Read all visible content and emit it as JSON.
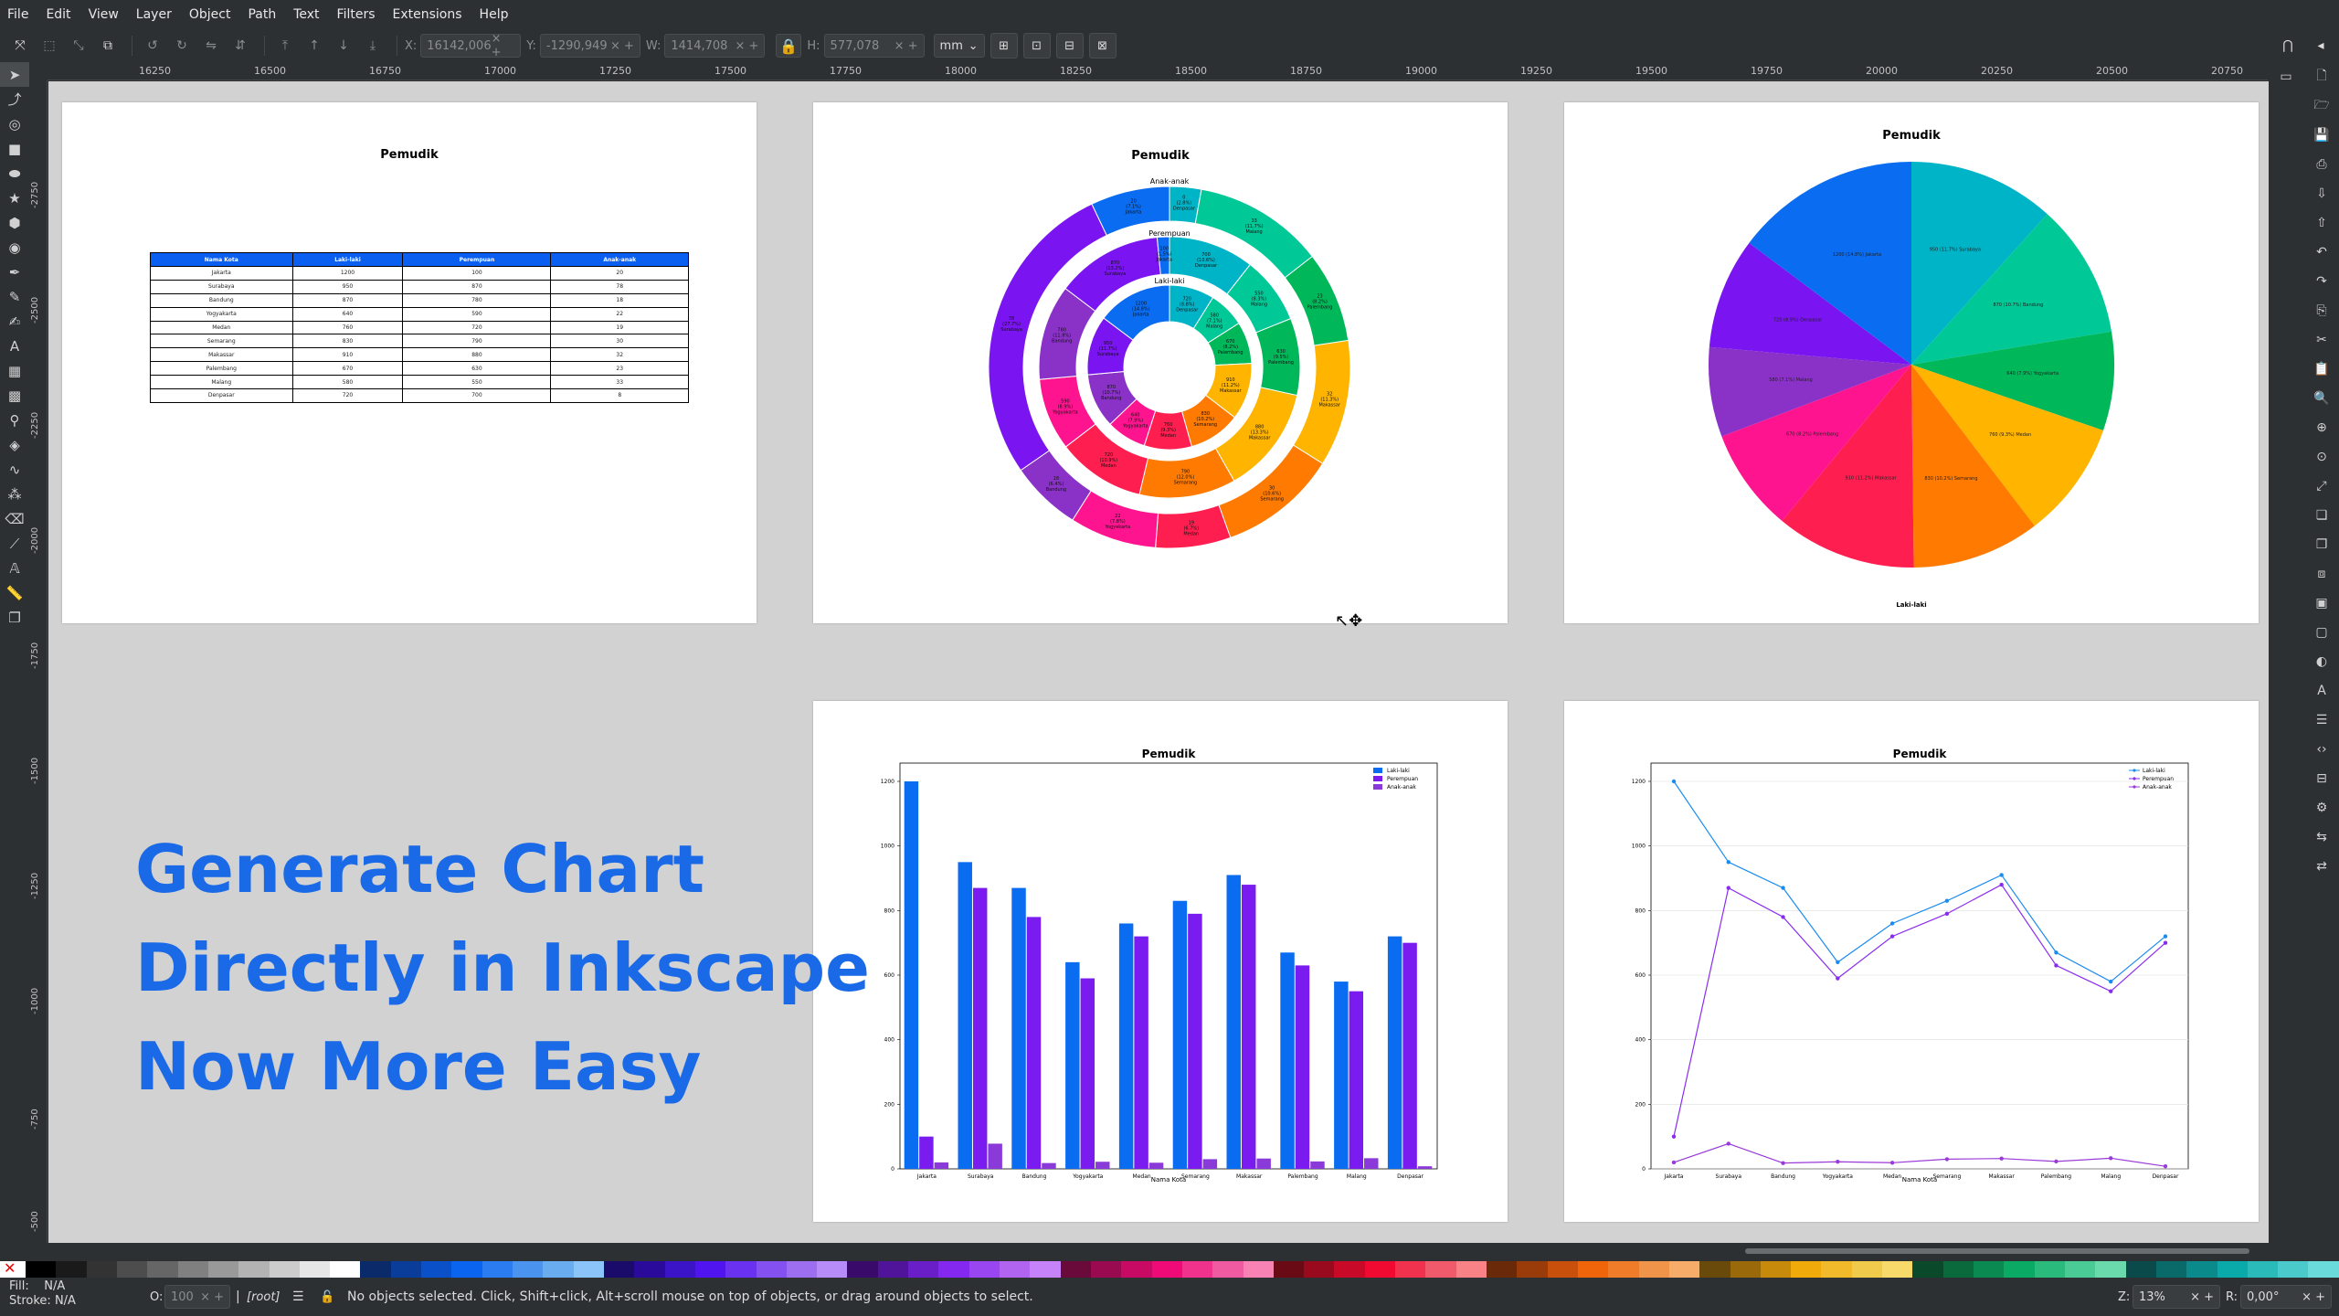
{
  "menubar": {
    "items": [
      "File",
      "Edit",
      "View",
      "Layer",
      "Object",
      "Path",
      "Text",
      "Filters",
      "Extensions",
      "Help"
    ]
  },
  "toolbar": {
    "x_label": "X:",
    "x_value": "16142,006",
    "y_label": "Y:",
    "y_value": "-1290,949",
    "w_label": "W:",
    "w_value": "1414,708",
    "h_label": "H:",
    "h_value": "577,078",
    "unit": "mm"
  },
  "ruler": {
    "h_labels": [
      "16250",
      "16500",
      "16750",
      "17000",
      "17250",
      "17500",
      "17750",
      "18000",
      "18250",
      "18500",
      "18750",
      "19000",
      "19250",
      "19500",
      "19750",
      "20000",
      "20250",
      "20500",
      "20750"
    ],
    "v_labels": [
      "-2750",
      "-2500",
      "-2250",
      "-2000",
      "-1750",
      "-1500",
      "-1250",
      "-1000",
      "-750",
      "-500"
    ]
  },
  "headline": [
    "Generate Chart",
    "Directly in Inkscape",
    "Now More Easy"
  ],
  "table_page": {
    "title": "Pemudik",
    "headers": [
      "Nama Kota",
      "Laki-laki",
      "Perempuan",
      "Anak-anak"
    ],
    "rows": [
      [
        "Jakarta",
        "1200",
        "100",
        "20"
      ],
      [
        "Surabaya",
        "950",
        "870",
        "78"
      ],
      [
        "Bandung",
        "870",
        "780",
        "18"
      ],
      [
        "Yogyakarta",
        "640",
        "590",
        "22"
      ],
      [
        "Medan",
        "760",
        "720",
        "19"
      ],
      [
        "Semarang",
        "830",
        "790",
        "30"
      ],
      [
        "Makassar",
        "910",
        "880",
        "32"
      ],
      [
        "Palembang",
        "670",
        "630",
        "23"
      ],
      [
        "Malang",
        "580",
        "550",
        "33"
      ],
      [
        "Denpasar",
        "720",
        "700",
        "8"
      ]
    ]
  },
  "chart_data": [
    {
      "type": "pie",
      "variant": "nested-donut",
      "title": "Pemudik",
      "ring_labels": [
        "Anak-anak",
        "Perempuan",
        "Laki-laki"
      ],
      "categories": [
        "Jakarta",
        "Surabaya",
        "Bandung",
        "Yogyakarta",
        "Medan",
        "Semarang",
        "Makassar",
        "Palembang",
        "Malang",
        "Denpasar"
      ],
      "series": [
        {
          "name": "Laki-laki",
          "values": [
            1200,
            950,
            870,
            640,
            760,
            830,
            910,
            670,
            580,
            720
          ]
        },
        {
          "name": "Perempuan",
          "values": [
            100,
            870,
            780,
            590,
            720,
            790,
            880,
            630,
            550,
            700
          ]
        },
        {
          "name": "Anak-anak",
          "values": [
            20,
            78,
            18,
            22,
            19,
            30,
            32,
            23,
            33,
            8
          ]
        }
      ],
      "labels_visible": {
        "outer": [
          "0\n(2.8%)\nDenpasar",
          "33\n(11.7%)\nMalang",
          "23\n(8.2%)\nPalembang",
          "32\n(11.3%)\nMakassar",
          "30\n(10.6%)\nSemarang",
          "19\n(6.7%)\nMedan",
          "22\n(7.8%)\nYogyakarta",
          "18\n(6.4%)\nBandung",
          "78\n(27.7%)\nSurabaya",
          "20\n(7.1%)\nJakarta"
        ],
        "middle": [
          "700\n(10.6%)\nDenpasar",
          "550\n(8.3%)\nMalang",
          "630\n(9.5%)\nPalembang",
          "880\n(13.3%)\nMakassar",
          "790\n(12.0%)\nSemarang",
          "720\n(10.9%)\nMedan",
          "590\n(8.9%)\nYogyakarta",
          "780\n(11.8%)\nBandung",
          "870\n(13.2%)\nSurabaya",
          "100\n(1.5%)\nJakarta"
        ],
        "inner": [
          "720\n(8.8%)\nDenpasar",
          "580\n(7.1%)\nMalang",
          "670\n(8.2%)\nPalembang",
          "910\n(11.2%)\nMakassar",
          "830\n(10.2%)\nSemarang",
          "760\n(9.3%)\nMedan",
          "640\n(7.9%)\nYogyakarta",
          "870\n(10.7%)\nBandung",
          "950\n(11.7%)\nSurabaya",
          "1200\n(14.8%)\nJakarta"
        ]
      }
    },
    {
      "type": "pie",
      "title": "Pemudik",
      "xlabel": "Laki-laki",
      "categories": [
        "Jakarta",
        "Surabaya",
        "Bandung",
        "Yogyakarta",
        "Medan",
        "Semarang",
        "Makassar",
        "Palembang",
        "Malang",
        "Denpasar"
      ],
      "values": [
        1200,
        950,
        870,
        640,
        760,
        830,
        910,
        670,
        580,
        720
      ]
    },
    {
      "type": "bar",
      "title": "Pemudik",
      "xlabel": "Nama Kota",
      "categories": [
        "Jakarta",
        "Surabaya",
        "Bandung",
        "Yogyakarta",
        "Medan",
        "Semarang",
        "Makassar",
        "Palembang",
        "Malang",
        "Denpasar"
      ],
      "series": [
        {
          "name": "Laki-laki",
          "values": [
            1200,
            950,
            870,
            640,
            760,
            830,
            910,
            670,
            580,
            720
          ],
          "color": "#0a6cf0"
        },
        {
          "name": "Perempuan",
          "values": [
            100,
            870,
            780,
            590,
            720,
            790,
            880,
            630,
            550,
            700
          ],
          "color": "#7a1cf0"
        },
        {
          "name": "Anak-anak",
          "values": [
            20,
            78,
            18,
            22,
            19,
            30,
            32,
            23,
            33,
            8
          ],
          "color": "#8a3ad8"
        }
      ],
      "yticks": [
        0,
        200,
        400,
        600,
        800,
        1000,
        1200
      ],
      "ylim": [
        0,
        1200
      ],
      "legend": "top-right"
    },
    {
      "type": "line",
      "title": "Pemudik",
      "xlabel": "Nama Kota",
      "categories": [
        "Jakarta",
        "Surabaya",
        "Bandung",
        "Yogyakarta",
        "Medan",
        "Semarang",
        "Makassar",
        "Palembang",
        "Malang",
        "Denpasar"
      ],
      "series": [
        {
          "name": "Laki-laki",
          "values": [
            1200,
            950,
            870,
            640,
            760,
            830,
            910,
            670,
            580,
            720
          ],
          "color": "#1a8cf0"
        },
        {
          "name": "Perempuan",
          "values": [
            100,
            870,
            780,
            590,
            720,
            790,
            880,
            630,
            550,
            700
          ],
          "color": "#8a2cf0"
        },
        {
          "name": "Anak-anak",
          "values": [
            20,
            78,
            18,
            22,
            19,
            30,
            32,
            23,
            33,
            8
          ],
          "color": "#9a3ad8"
        }
      ],
      "yticks": [
        0,
        200,
        400,
        600,
        800,
        1000,
        1200
      ],
      "ylim": [
        0,
        1200
      ],
      "grid": true,
      "legend": "top-right"
    }
  ],
  "pie_colors": [
    "#0a6cf0",
    "#00b4c8",
    "#00c896",
    "#00b85a",
    "#ffb400",
    "#ff7a00",
    "#ff1e50",
    "#ff1490",
    "#8a32c8",
    "#7a14f0"
  ],
  "palette_colors": [
    "#000000",
    "#1a1a1a",
    "#333333",
    "#4d4d4d",
    "#666666",
    "#808080",
    "#999999",
    "#b3b3b3",
    "#cccccc",
    "#e6e6e6",
    "#ffffff",
    "#0a2a6a",
    "#0a3c9a",
    "#0a50c8",
    "#0a64f0",
    "#2a7cf0",
    "#4a94f0",
    "#6aacf0",
    "#8ac4f8",
    "#1a0a6a",
    "#2a0a9a",
    "#3c14c8",
    "#5014f0",
    "#6a32f0",
    "#8450f0",
    "#9e6ef0",
    "#b88cf8",
    "#3a0a6a",
    "#50149a",
    "#6a1ec8",
    "#8428f0",
    "#9a46f0",
    "#b064f0",
    "#c682f8",
    "#6a0a3a",
    "#9a0a50",
    "#c80a64",
    "#f00a78",
    "#f0328c",
    "#f05aa0",
    "#f882b4",
    "#6a0a14",
    "#9a0a1e",
    "#c80a28",
    "#f00a32",
    "#f0324e",
    "#f05a6a",
    "#f88286",
    "#6a2a0a",
    "#9a3c0a",
    "#c8500a",
    "#f0640a",
    "#f07c2a",
    "#f0944a",
    "#f8ac6a",
    "#6a4a0a",
    "#9a6a0a",
    "#c88a0a",
    "#f0aa0a",
    "#f0ba2a",
    "#f0ca4a",
    "#f8da6a",
    "#0a4a2a",
    "#0a6a3c",
    "#0a8a50",
    "#0aaa64",
    "#2aba7c",
    "#4aca94",
    "#6adaac",
    "#0a4a4a",
    "#0a6a6a",
    "#0a8a8a",
    "#0aaaaa",
    "#2ababa",
    "#4acaca",
    "#6adada"
  ],
  "statusbar": {
    "fill_label": "Fill:",
    "fill_value": "N/A",
    "stroke_label": "Stroke:",
    "stroke_value": "N/A",
    "opacity_label": "O:",
    "opacity_value": "100",
    "layer": "[root]",
    "message": "No objects selected. Click, Shift+click, Alt+scroll mouse on top of objects, or drag around objects to select.",
    "zoom_label": "Z:",
    "zoom_value": "13%",
    "rotate_label": "R:",
    "rotate_value": "0,00°"
  }
}
